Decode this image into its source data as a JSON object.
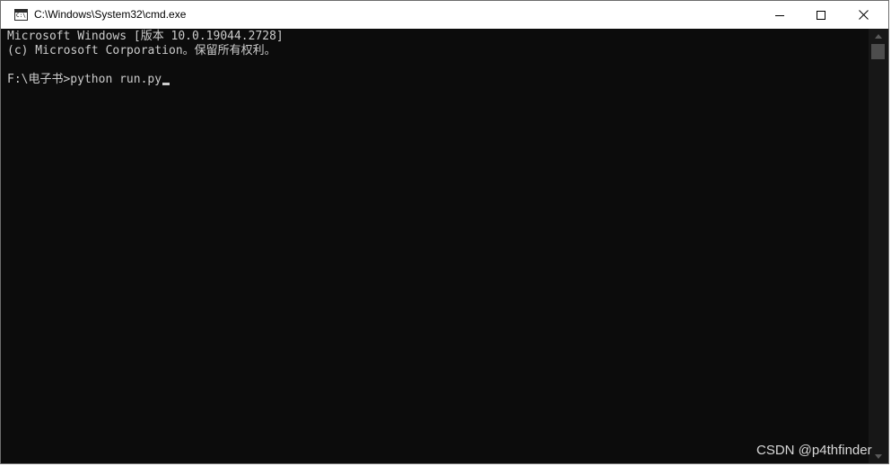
{
  "window": {
    "title": "C:\\Windows\\System32\\cmd.exe",
    "icon": "cmd-console-icon",
    "icon_text": "C:\\"
  },
  "caption_buttons": {
    "minimize_icon": "minimize-icon",
    "maximize_icon": "maximize-icon",
    "close_icon": "close-icon"
  },
  "console": {
    "lines": [
      "Microsoft Windows [版本 10.0.19044.2728]",
      "(c) Microsoft Corporation。保留所有权利。",
      "F:\\电子书>python run.py"
    ],
    "foreground": "#cccccc",
    "background": "#0c0c0c"
  },
  "watermark": {
    "text": "CSDN @p4thfinder"
  }
}
